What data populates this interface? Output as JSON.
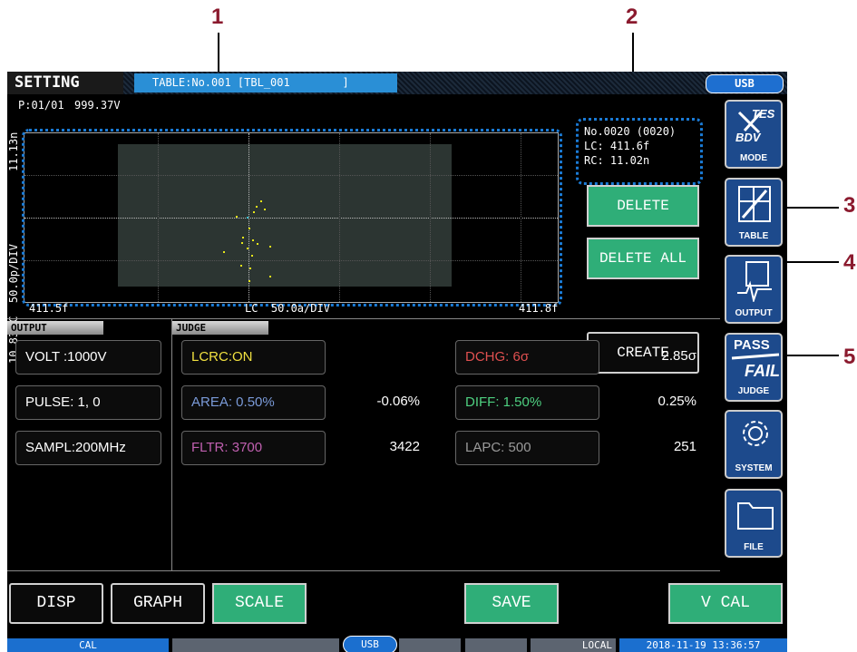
{
  "callouts": [
    "1",
    "2",
    "3",
    "4",
    "5"
  ],
  "header": {
    "title": "SETTING",
    "table_label": "TABLE:No.001 [TBL_001        ]",
    "interface": "USB"
  },
  "plot": {
    "page_info": "P:01/01",
    "voltage": "999.37V",
    "y_top": "11.13n",
    "y_bottom": "10.83n",
    "y_axis": "RC  50.0p/DIV",
    "x_left": "411.5f",
    "x_axis": "LC  50.0a/DIV",
    "x_right": "411.8f"
  },
  "selected_point": {
    "number": "No.0020 (0020)",
    "lc": "LC: 411.6f",
    "rc": "RC: 11.02n"
  },
  "buttons": {
    "delete": "DELETE",
    "delete_all": "DELETE ALL",
    "create": "CREATE"
  },
  "sidebar": [
    {
      "label": "MODE",
      "icon": "test-bdv-icon"
    },
    {
      "label": "TABLE",
      "icon": "table-tools-icon"
    },
    {
      "label": "OUTPUT",
      "icon": "output-waveform-icon"
    },
    {
      "label": "JUDGE",
      "icon": "pass-fail-icon"
    },
    {
      "label": "SYSTEM",
      "icon": "gear-icon"
    },
    {
      "label": "FILE",
      "icon": "folder-icon"
    }
  ],
  "output_panel": {
    "tab": "OUTPUT",
    "volt": "VOLT :1000V",
    "pulse": "PULSE: 1, 0",
    "sampl": "SAMPL:200MHz"
  },
  "judge_panel": {
    "tab": "JUDGE",
    "lcrc": "LCRC:ON",
    "dchg": "DCHG: 6σ",
    "dchg_value": "2.85σ",
    "area": "AREA: 0.50%",
    "area_value": "-0.06%",
    "diff": "DIFF: 1.50%",
    "diff_value": "0.25%",
    "fltr": "FLTR: 3700",
    "fltr_value": "3422",
    "lapc": "LAPC: 500",
    "lapc_value": "251"
  },
  "bottom_buttons": {
    "disp": "DISP",
    "graph": "GRAPH",
    "scale": "SCALE",
    "save": "SAVE",
    "vcal": "V CAL"
  },
  "statusbar": {
    "cal": "CAL",
    "usb": "USB",
    "local": "LOCAL",
    "datetime": "2018-11-19 13:36:57"
  },
  "colors": {
    "green_button": "#2fae78",
    "accent_blue": "#1b6fcf",
    "lcrc_text": "#f0e040",
    "area_text": "#7a9ad8",
    "fltr_text": "#c060b0",
    "dchg_text": "#e05050",
    "diff_text": "#4ed080",
    "lapc_text": "#9a9a9a",
    "scatter_point": "#e6e61a"
  }
}
